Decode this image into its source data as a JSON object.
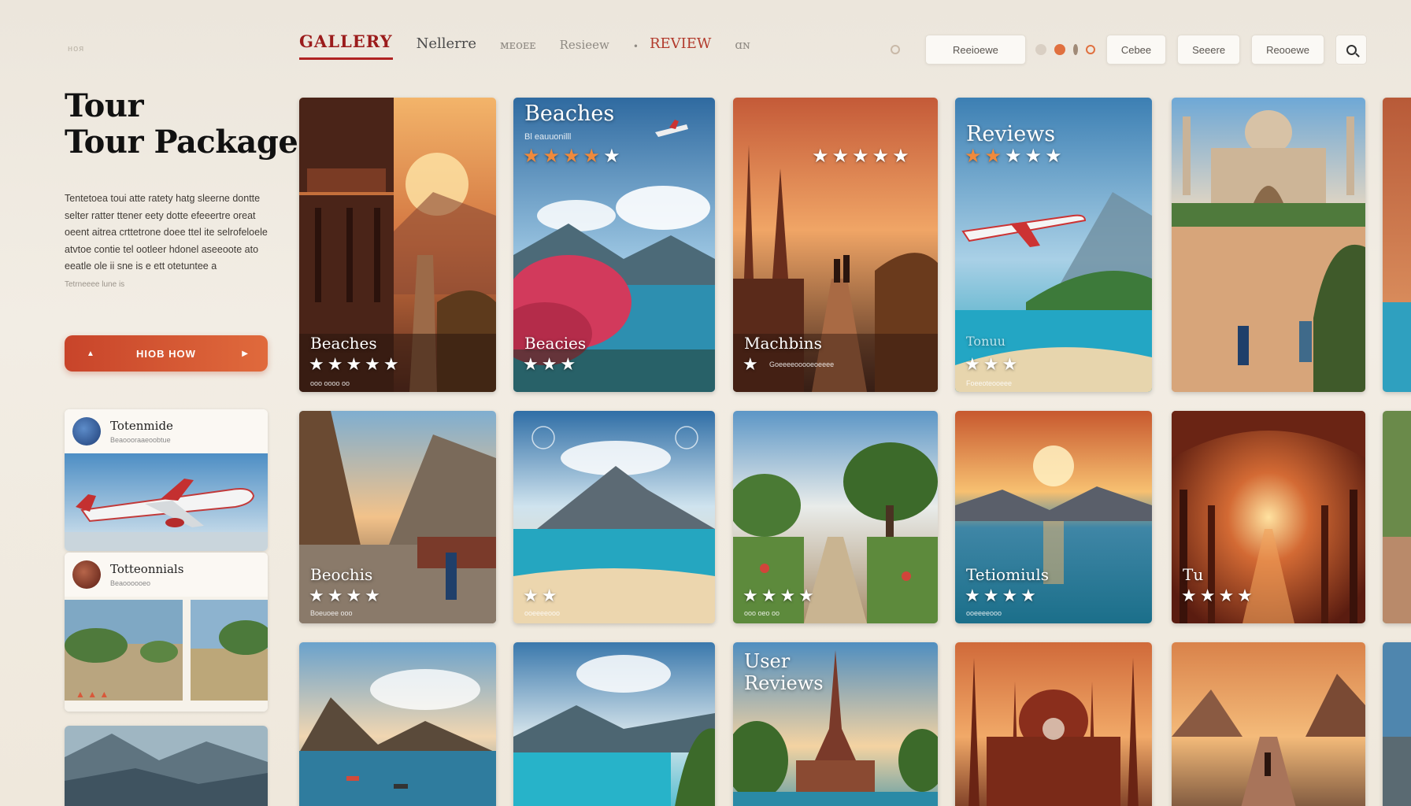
{
  "header": {
    "brand": "ноя",
    "nav": [
      {
        "label": "GALLERY",
        "style": "active"
      },
      {
        "label": "Nellerre",
        "style": "normal"
      },
      {
        "label": "ᴍᴇᴏᴇᴇ",
        "style": "faint"
      },
      {
        "label": "Resieew",
        "style": "normal"
      },
      {
        "label": "•",
        "style": "dot"
      },
      {
        "label": "REVIEW",
        "style": "red"
      },
      {
        "label": "ɑɴ",
        "style": "faint"
      }
    ],
    "buttons": [
      "Reeioewe",
      "Cebee",
      "Seeere",
      "Reooewe"
    ],
    "accent": "#b02323"
  },
  "hero": {
    "title_line1": "Tour",
    "title_line2": "Tour Package",
    "description": "Tentetoea toui atte ratety hatg sleerne dontte selter ratter ttener eety dotte efeeertre oreat oeent aitrea crttetrone doee ttel ite selrofeloele atvtoe contie tel ootleer hdonel aseeoote ato eeatle ole ii sne is e ett otetuntee a",
    "small_print": "Tetrneeee lune is",
    "cta_label": "HIOB HOW"
  },
  "sidebar_cards": [
    {
      "title": "Totenmide",
      "subtitle": "Beaoooraaeoobtue"
    },
    {
      "title": "Totteonnials",
      "subtitle": "Beaoooooeo"
    },
    {
      "title": "",
      "subtitle": ""
    }
  ],
  "gallery": {
    "row1": [
      {
        "label": "Beaches",
        "stars": 5,
        "sub": "ooo oooo oo"
      },
      {
        "top_title": "Beaches",
        "top_sub": "Bl eauuonilll",
        "top_stars": 5,
        "label": "Beacies",
        "stars": 3
      },
      {
        "top_stars": 5,
        "label": "Machbins",
        "stars": 1,
        "sub": "Goeeeeooooeoeeee"
      },
      {
        "top_title": "Reviews",
        "top_stars": 5,
        "label": "Tonuu",
        "stars": 3,
        "sub": "Foeeoteooeee"
      },
      {
        "label": "",
        "stars": 0
      }
    ],
    "row2": [
      {
        "label": "Beochis",
        "stars": 4,
        "sub": "Boeuoee ooo"
      },
      {
        "label": "",
        "stars": 2,
        "sub": "ooeeeeooo"
      },
      {
        "label": "",
        "stars": 4,
        "sub": "ooo oeo oo"
      },
      {
        "label": "Tetiomiuls",
        "stars": 4,
        "sub": "ooeeeeooo"
      },
      {
        "label": "Tu",
        "stars": 4,
        "sub": ""
      }
    ],
    "row3": [
      {
        "label": ""
      },
      {
        "label": ""
      },
      {
        "top_title": "User Reviews"
      },
      {
        "label": ""
      },
      {
        "label": ""
      }
    ]
  }
}
